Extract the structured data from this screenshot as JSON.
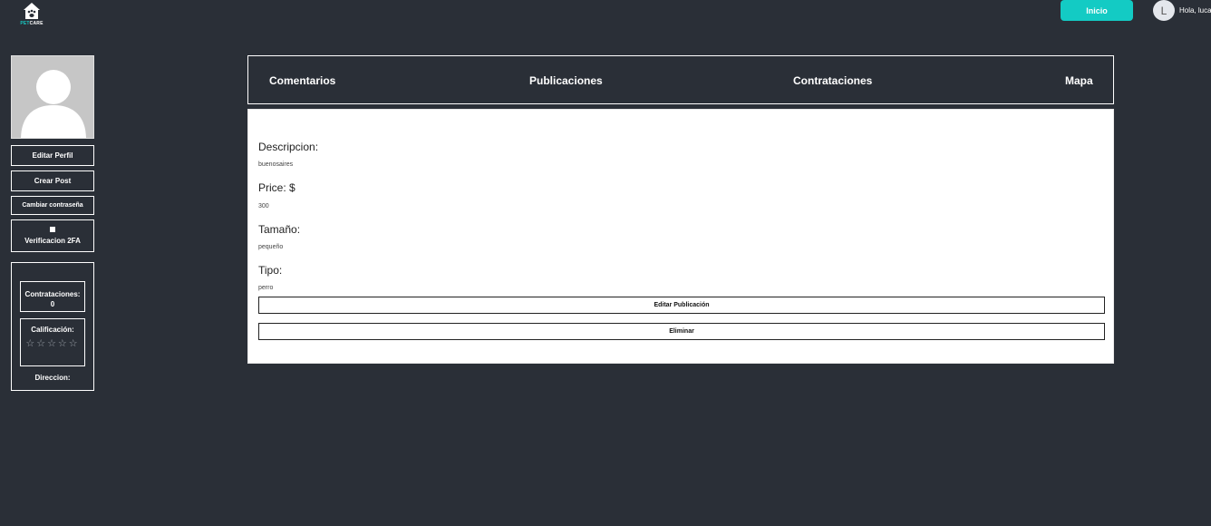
{
  "header": {
    "logo_pet": "PET",
    "logo_care": "CARE",
    "inicio_label": "Inicio",
    "avatar_initial": "L",
    "greeting": "Hola, lucas"
  },
  "sidebar": {
    "editar_perfil": "Editar Perfil",
    "crear_post": "Crear Post",
    "cambiar_contrasena": "Cambiar contraseña",
    "verificacion_2fa": "Verificacion 2FA",
    "stats": {
      "contrataciones_label": "Contrataciones:",
      "contrataciones_value": "0",
      "calificacion_label": "Calificación:",
      "stars": "☆☆☆☆☆",
      "rating": 0,
      "direccion_label": "Direccion:"
    }
  },
  "tabs": [
    "Comentarios",
    "Publicaciones",
    "Contrataciones",
    "Mapa"
  ],
  "post": {
    "descripcion_label": "Descripcion:",
    "descripcion_value": "buenosaires",
    "price_label": "Price: $",
    "price_value": "300",
    "tamano_label": "Tamaño:",
    "tamano_value": "pequeño",
    "tipo_label": "Tipo:",
    "tipo_value": "perro",
    "editar_label": "Editar Publicación",
    "eliminar_label": "Eliminar"
  },
  "colors": {
    "background": "#2a2f37",
    "accent": "#13cbc4"
  }
}
